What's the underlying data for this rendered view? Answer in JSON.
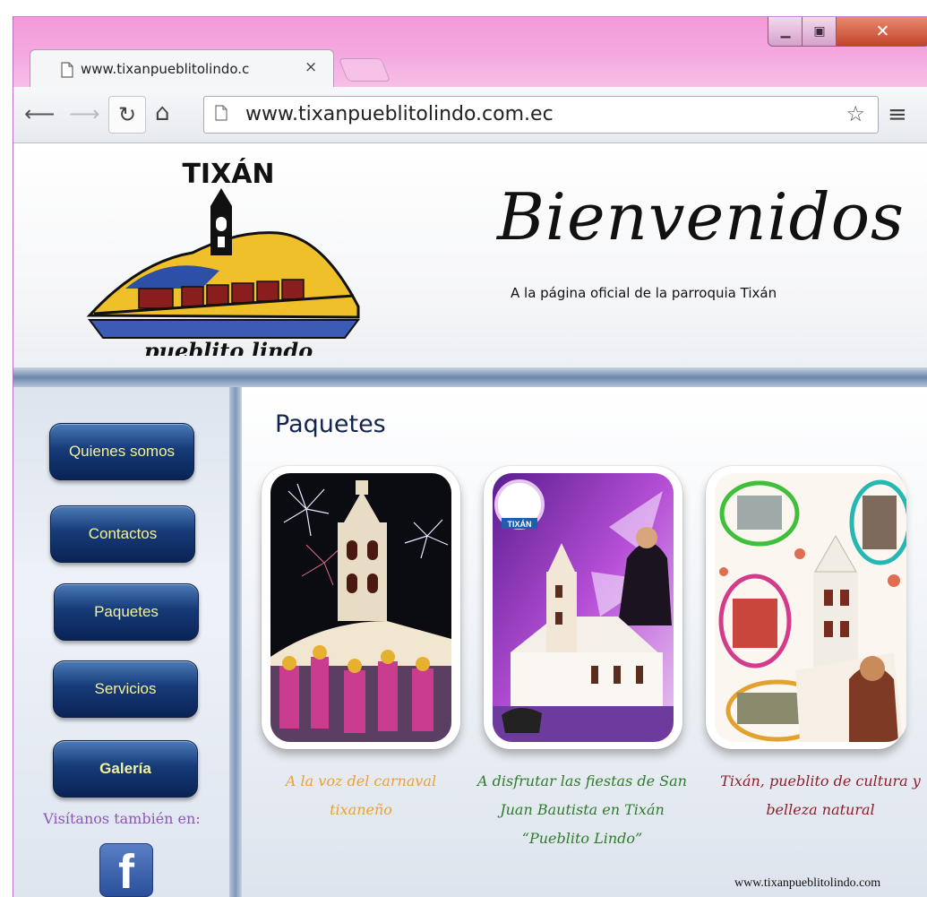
{
  "browser": {
    "tab_title": "www.tixanpueblitolindo.c",
    "tab_close": "×",
    "url": "www.tixanpueblitolindo.com.ec",
    "icons": [
      "page-icon",
      "back-arrow-icon",
      "forward-arrow-icon",
      "reload-icon",
      "home-icon",
      "star-icon",
      "menu-icon",
      "minimize-icon",
      "maximize-icon",
      "close-icon"
    ]
  },
  "header": {
    "logo_top_text": "TIXÁN",
    "logo_bottom_text": "pueblito lindo",
    "title": "Bienvenidos",
    "subtitle": "A la página oficial de la parroquia Tixán"
  },
  "sidebar": {
    "items": [
      {
        "label": "Quienes somos"
      },
      {
        "label": "Contactos"
      },
      {
        "label": "Paquetes"
      },
      {
        "label": "Servicios"
      },
      {
        "label": "Galería"
      }
    ],
    "visit_label": "Visítanos también en:",
    "social_icon_letter": "f"
  },
  "main": {
    "section_title": "Paquetes",
    "packages": [
      {
        "caption": "A la voz del carnaval tixaneño"
      },
      {
        "caption": "A disfrutar las fiestas de San Juan Bautista en Tixán “Pueblito Lindo”",
        "badge": "TIXÁN"
      },
      {
        "caption": "Tixán, pueblito de cultura y belleza natural"
      }
    ],
    "footer_url": "www.tixanpueblitolindo.com"
  },
  "colors": {
    "button_text": "#f5f19a",
    "button_bg": "#163b78",
    "titlebar": "#f59ad9",
    "caption_1": "#e8a03a",
    "caption_2": "#2f7a2c",
    "caption_3": "#8c1f2a"
  }
}
